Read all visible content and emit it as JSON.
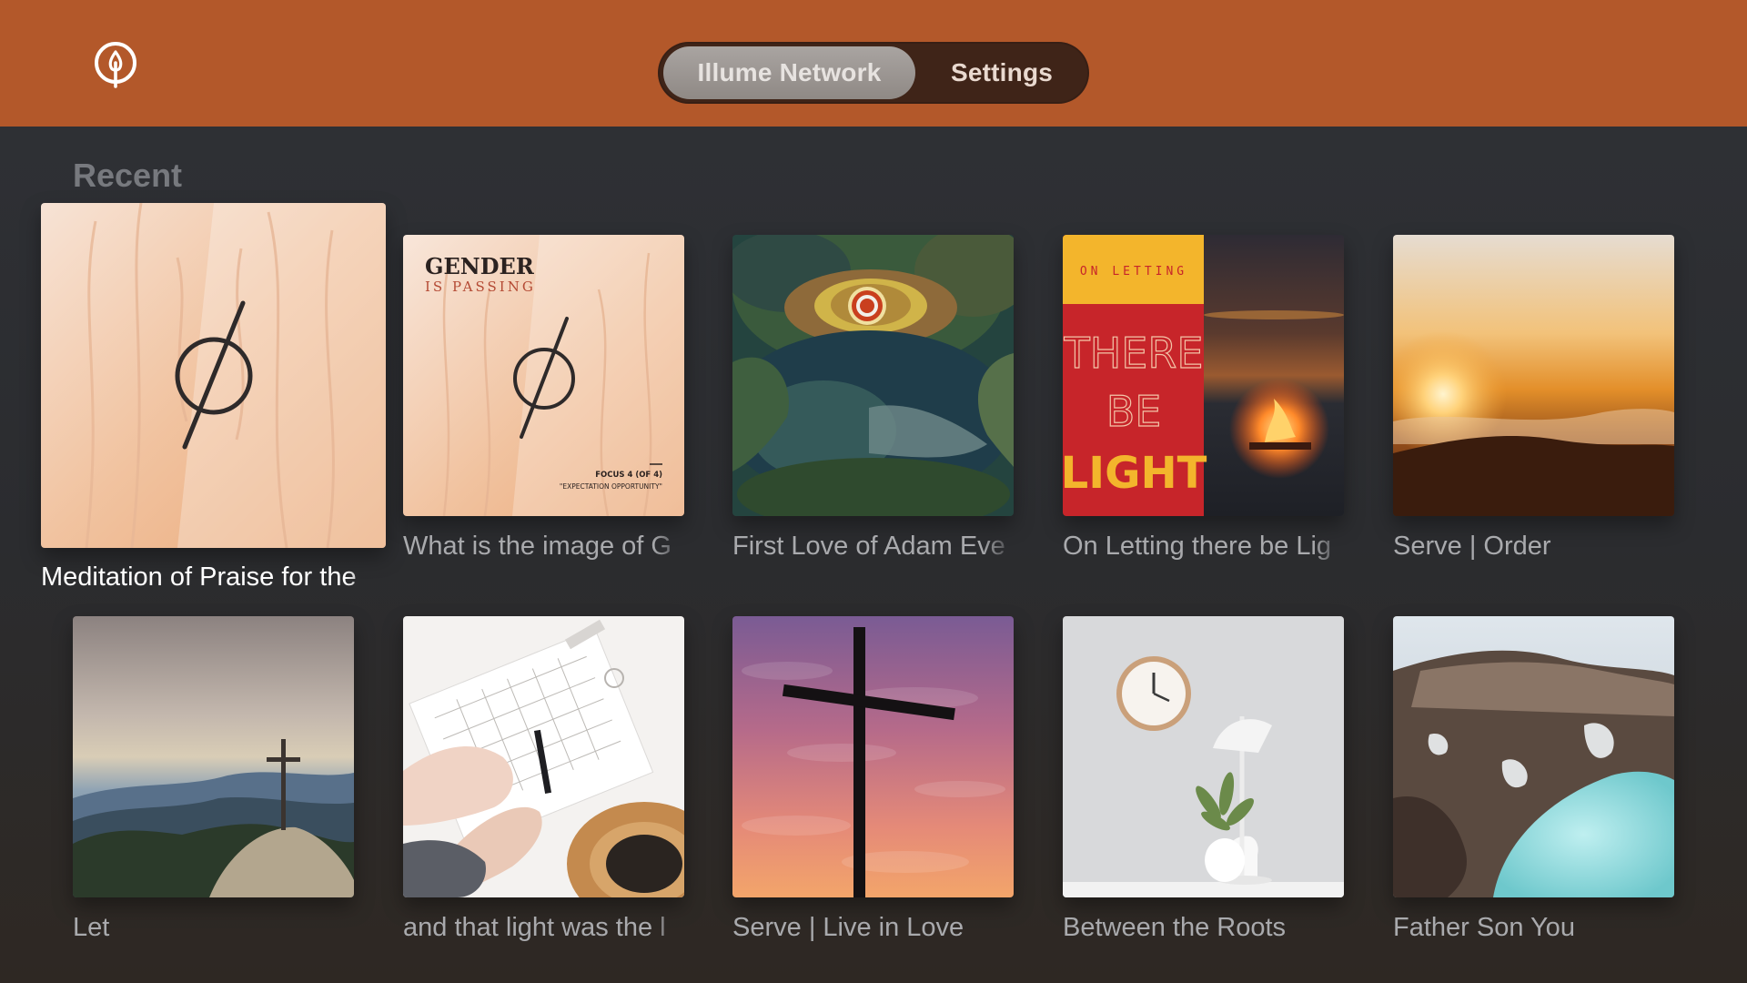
{
  "header": {
    "logo_icon": "flame-drop-icon",
    "tabs": [
      {
        "label": "Illume Network",
        "selected": true
      },
      {
        "label": "Settings",
        "selected": false
      }
    ],
    "accent_color": "#b3582a"
  },
  "section": {
    "title": "Recent",
    "items": [
      {
        "caption": "Meditation of Praise for the",
        "focused": true,
        "art": "figure-circle-slash"
      },
      {
        "caption": "What is the image of G",
        "art": "gender-is-passing-cover",
        "art_text": {
          "title": "GENDER",
          "subtitle": "IS PASSING",
          "focus": "FOCUS 4 (OF 4)",
          "tagline": "\"EXPECTATION OPPORTUNITY\""
        }
      },
      {
        "caption": "First Love of Adam Eve",
        "art": "painting-garden-eye"
      },
      {
        "caption": "On Letting there be Lig",
        "art": "there-be-light-cover",
        "art_text": {
          "top": "ON LETTING",
          "line1": "THERE",
          "line2": "BE",
          "line3": "LIGHT"
        }
      },
      {
        "caption": "Serve | Order",
        "art": "sunrise-over-clouds"
      },
      {
        "caption": "Let",
        "art": "cross-on-mountain"
      },
      {
        "caption": "and that light was the l",
        "art": "hands-writing-planner"
      },
      {
        "caption": "Serve | Live in Love",
        "art": "cross-silhouette-sunset"
      },
      {
        "caption": "Between the Roots",
        "art": "clock-plant-lamp"
      },
      {
        "caption": "Father Son You",
        "art": "crater-lake"
      }
    ]
  }
}
